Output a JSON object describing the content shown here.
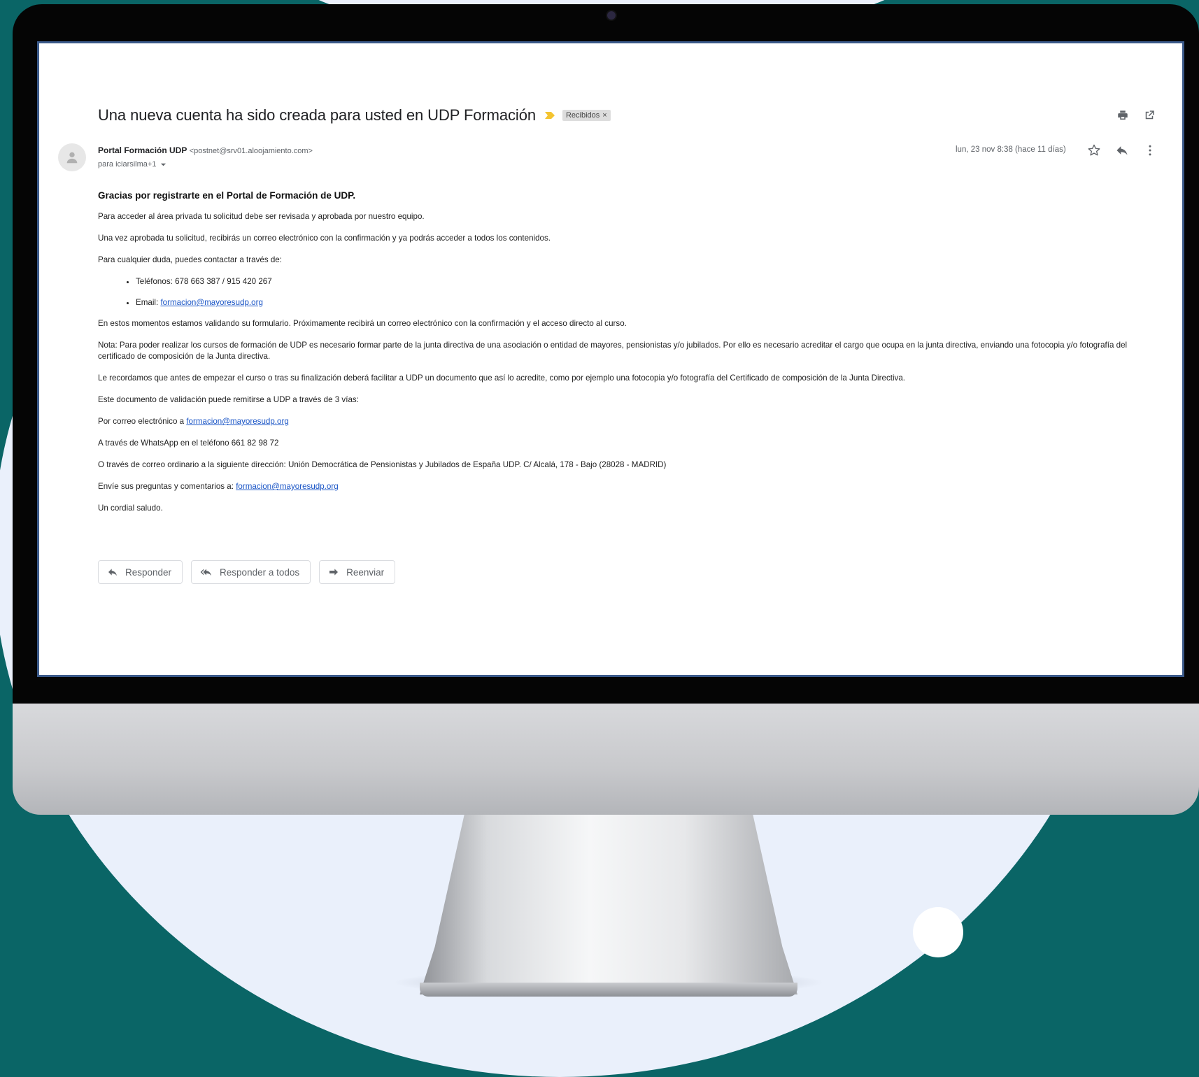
{
  "email": {
    "subject": "Una nueva cuenta ha sido creada para usted en UDP Formación",
    "label": "Recibidos",
    "label_remove": "×",
    "sender_name": "Portal Formación UDP",
    "sender_email": "<postnet@srv01.aloojamiento.com>",
    "recipients": "para iciarsilma+1",
    "date": "lun, 23 nov 8:38 (hace 11 días)"
  },
  "body": {
    "heading": "Gracias por registrarte en el Portal de Formación de UDP.",
    "p1": "Para acceder al área privada tu solicitud debe ser revisada y aprobada por nuestro equipo.",
    "p2": "Una vez aprobada tu solicitud, recibirás un correo electrónico con la confirmación y ya podrás acceder a todos los contenidos.",
    "p3": "Para cualquier duda, puedes contactar a través de:",
    "phones": "Teléfonos: 678 663 387 / 915 420 267",
    "email_label": "Email: ",
    "email_link": "formacion@mayoresudp.org",
    "p4": "En estos momentos estamos validando su formulario. Próximamente recibirá un correo electrónico con la confirmación y el acceso directo al curso.",
    "p5": "Nota: Para poder realizar los cursos de formación de UDP es necesario formar parte de la junta directiva de una asociación o entidad de mayores, pensionistas y/o jubilados. Por ello es necesario acreditar el cargo que ocupa en la junta directiva, enviando una fotocopia y/o fotografía del certificado de composición de la Junta directiva.",
    "p6": "Le recordamos que antes de empezar el curso o tras su finalización deberá facilitar a UDP un documento que así lo acredite, como por ejemplo una fotocopia y/o fotografía del Certificado de composición de la Junta Directiva.",
    "p7": "Este documento de validación puede remitirse a UDP a través de 3 vías:",
    "p8_prefix": "Por correo electrónico a ",
    "p8_link": "formacion@mayoresudp.org",
    "p9": "A través de WhatsApp en el teléfono 661 82 98 72",
    "p10": "O través de correo ordinario a la siguiente dirección: Unión Democrática de Pensionistas y Jubilados de España UDP. C/ Alcalá, 178 - Bajo (28028 - MADRID)",
    "p11_prefix": "Envíe sus preguntas y comentarios a: ",
    "p11_link": "formacion@mayoresudp.org",
    "p12": "Un cordial saludo."
  },
  "actions": {
    "reply": "Responder",
    "reply_all": "Responder a todos",
    "forward": "Reenviar"
  },
  "colors": {
    "background_teal": "#0a6566",
    "background_light": "#eaf0fb",
    "link": "#1a55c6",
    "importance": "#f4c430"
  }
}
